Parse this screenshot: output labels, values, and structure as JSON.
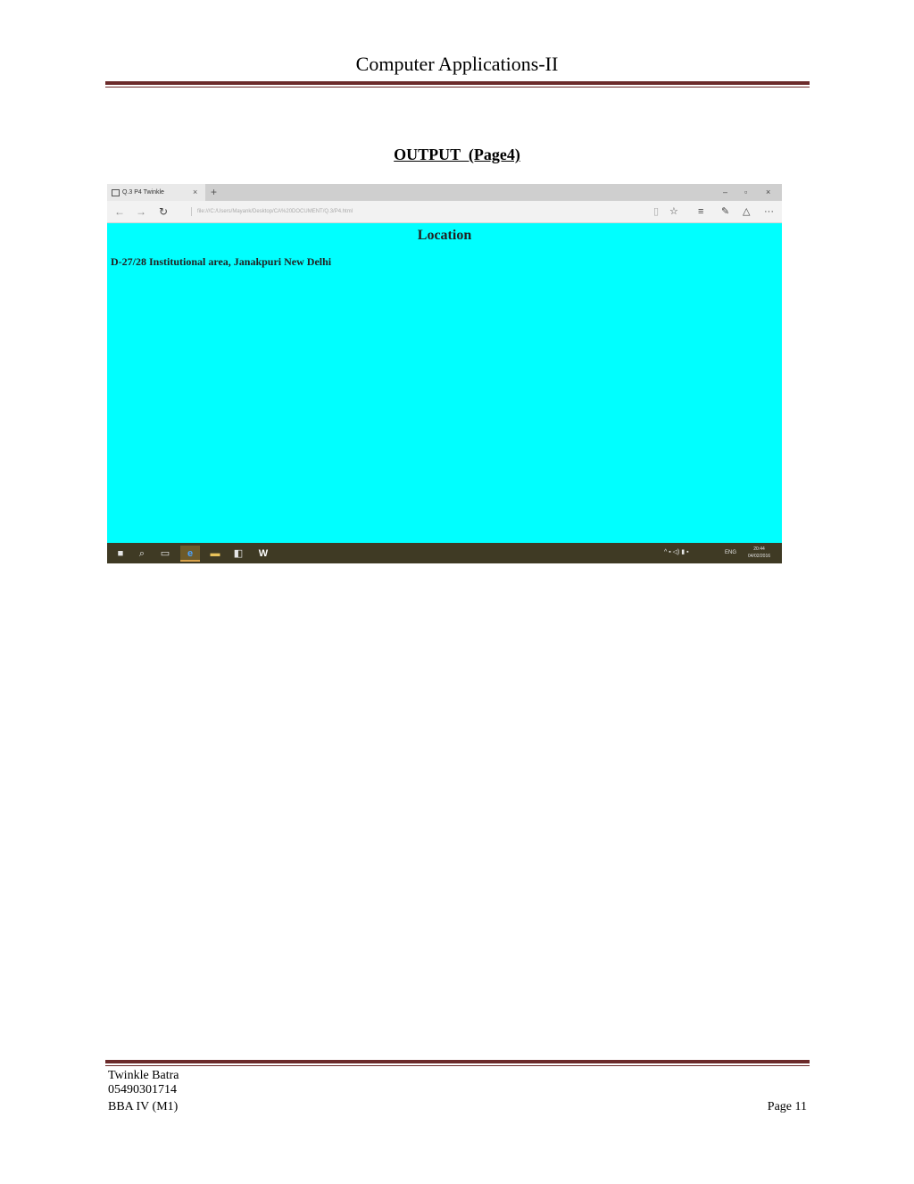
{
  "header": {
    "title": "Computer Applications-II"
  },
  "section": {
    "heading": "OUTPUT  (Page4)"
  },
  "screenshot": {
    "tab_title": "Q.3 P4 Twinkle",
    "tab_close": "×",
    "tab_new": "+",
    "window_controls": {
      "minimize": "–",
      "maximize": "▫",
      "close": "×"
    },
    "nav": {
      "back": "←",
      "forward": "→",
      "refresh": "↻"
    },
    "address": "file:///C:/Users/Mayank/Desktop/CA%20DOCUMENT/Q.3/P4.html",
    "toolbar_icons": {
      "reading_view": "▯",
      "favorite": "☆",
      "hub": "≡",
      "web_note": "✎",
      "share": "△",
      "more": "···"
    },
    "page": {
      "heading": "Location",
      "address_line": "D-27/28 Institutional area, Janakpuri New Delhi",
      "background": "#00ffff"
    },
    "taskbar": {
      "start": "■",
      "search": "⌕",
      "task_view": "▭",
      "edge": "e",
      "explorer": "▬",
      "store": "◧",
      "word": "W",
      "tray": "^ ▪ ◁) ▮ ▪",
      "lang": "ENG",
      "time": "20:44",
      "date": "04/02/2016"
    }
  },
  "footer": {
    "name": "Twinkle Batra",
    "id": "05490301714",
    "course": "BBA IV (M1)",
    "page": "Page 11"
  }
}
